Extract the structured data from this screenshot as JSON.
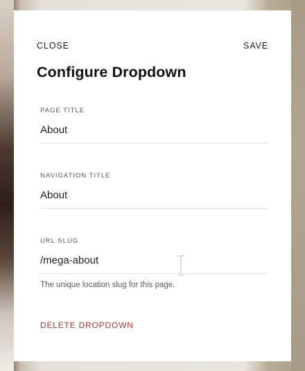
{
  "modal": {
    "close_label": "CLOSE",
    "save_label": "SAVE",
    "title": "Configure Dropdown"
  },
  "fields": {
    "page_title": {
      "label": "PAGE TITLE",
      "value": "About"
    },
    "navigation_title": {
      "label": "NAVIGATION TITLE",
      "value": "About"
    },
    "url_slug": {
      "label": "URL SLUG",
      "value": "/mega-about",
      "help": "The unique location slug for this page."
    }
  },
  "actions": {
    "delete_label": "DELETE DROPDOWN"
  },
  "colors": {
    "danger": "#a63a3a",
    "text": "#111111",
    "divider": "#e3e3e3"
  },
  "icons": {
    "text_cursor": "text-cursor-icon"
  }
}
